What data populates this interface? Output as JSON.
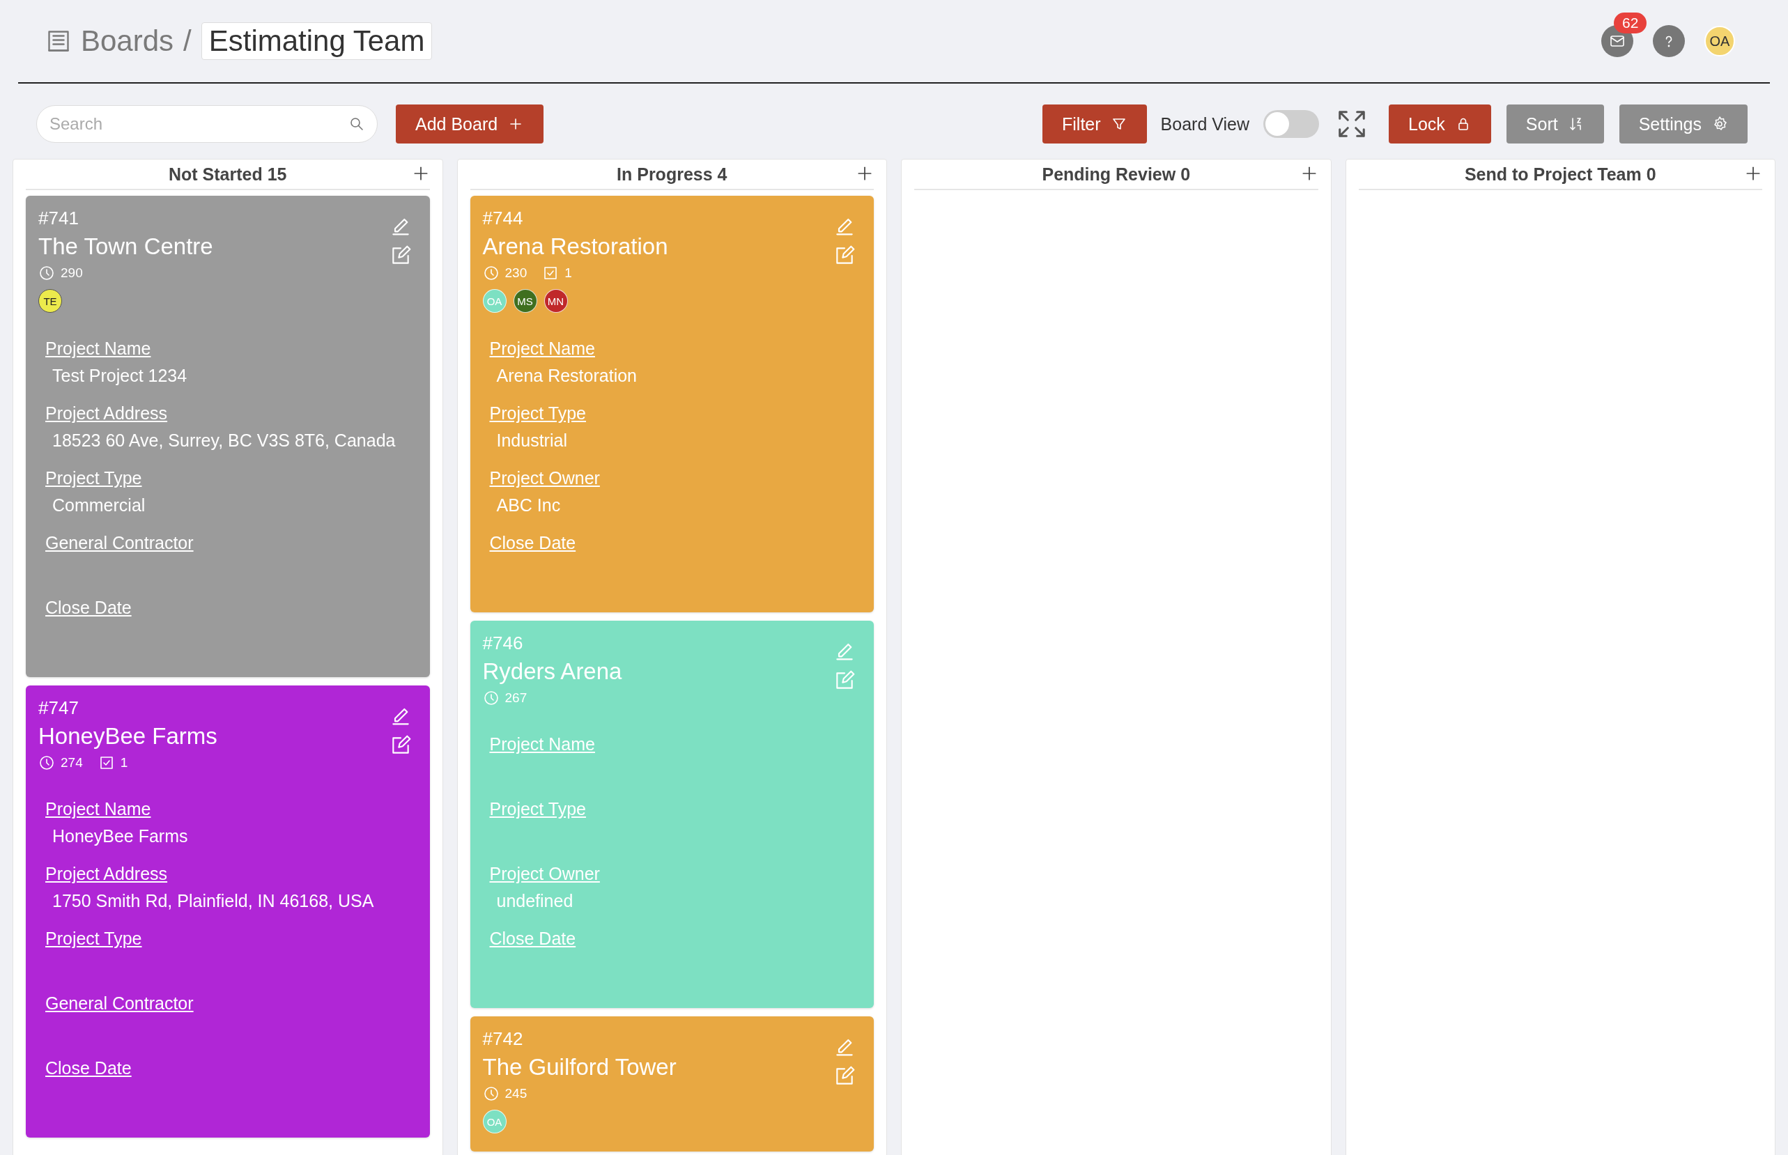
{
  "breadcrumb": {
    "root": "Boards",
    "separator": "/",
    "current": "Estimating Team"
  },
  "header": {
    "notifications": "62",
    "user_initials": "OA"
  },
  "toolbar": {
    "search_placeholder": "Search",
    "add_board": "Add Board",
    "filter": "Filter",
    "board_view_label": "Board View",
    "board_view_on": false,
    "lock": "Lock",
    "sort": "Sort",
    "settings": "Settings"
  },
  "columns": [
    {
      "title": "Not Started 15",
      "cards": [
        {
          "number": "#741",
          "title": "The Town Centre",
          "color": "#9b9b9b",
          "time": "290",
          "members": [
            {
              "initials": "TE",
              "color": "#ecea4c"
            }
          ],
          "fields": [
            {
              "label": "Project Name",
              "value": "Test Project 1234"
            },
            {
              "label": "Project Address",
              "value": "18523 60 Ave, Surrey, BC V3S 8T6, Canada"
            },
            {
              "label": "Project Type",
              "value": "Commercial"
            },
            {
              "label": "General Contractor"
            },
            {
              "label": "Close Date"
            }
          ]
        },
        {
          "number": "#747",
          "title": "HoneyBee Farms",
          "color": "#b026d6",
          "time": "274",
          "checklist": "1",
          "fields": [
            {
              "label": "Project Name",
              "value": "HoneyBee Farms"
            },
            {
              "label": "Project Address",
              "value": "1750 Smith Rd, Plainfield, IN 46168, USA"
            },
            {
              "label": "Project Type"
            },
            {
              "label": "General Contractor"
            },
            {
              "label": "Close Date"
            }
          ]
        }
      ]
    },
    {
      "title": "In Progress 4",
      "cards": [
        {
          "number": "#744",
          "title": "Arena Restoration",
          "color": "#e8a842",
          "time": "230",
          "checklist": "1",
          "members": [
            {
              "initials": "OA",
              "color": "#7de0c2"
            },
            {
              "initials": "MS",
              "color": "#3f6f1f"
            },
            {
              "initials": "MN",
              "color": "#c0282a"
            }
          ],
          "fields": [
            {
              "label": "Project Name",
              "value": "Arena Restoration"
            },
            {
              "label": "Project Type",
              "value": "Industrial"
            },
            {
              "label": "Project Owner",
              "value": "ABC Inc"
            },
            {
              "label": "Close Date"
            }
          ]
        },
        {
          "number": "#746",
          "title": "Ryders Arena",
          "color": "#7de0c2",
          "time": "267",
          "fields": [
            {
              "label": "Project Name"
            },
            {
              "label": "Project Type"
            },
            {
              "label": "Project Owner",
              "value": "undefined"
            },
            {
              "label": "Close Date"
            }
          ]
        },
        {
          "number": "#742",
          "title": "The Guilford Tower",
          "color": "#e8a842",
          "time": "245",
          "members": [
            {
              "initials": "OA",
              "color": "#7de0c2"
            }
          ]
        }
      ]
    },
    {
      "title": "Pending Review 0"
    },
    {
      "title": "Send to Project Team 0"
    }
  ]
}
